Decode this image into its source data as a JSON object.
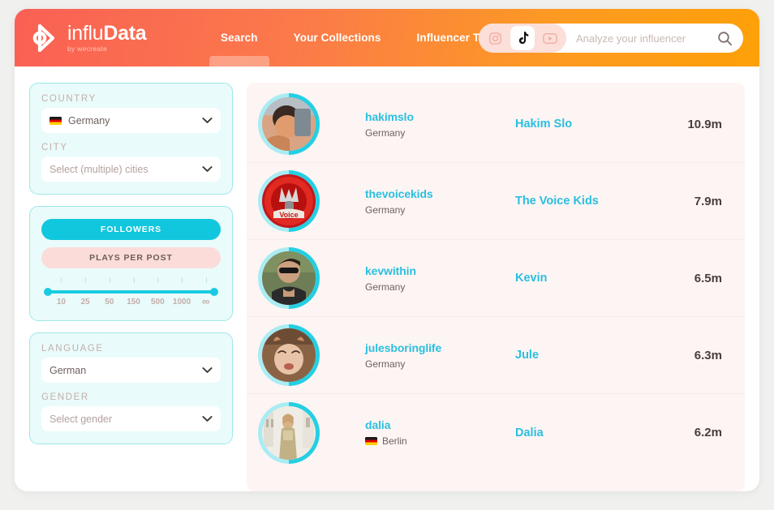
{
  "brand": {
    "name_light": "influ",
    "name_bold": "Data",
    "tagline": "by wecreate",
    "logo_icon": "infludata-logo-icon",
    "gradient_start": "#fa6055",
    "gradient_end": "#fda008"
  },
  "nav": {
    "items": [
      {
        "label": "Search",
        "active": true
      },
      {
        "label": "Your Collections",
        "active": false
      },
      {
        "label": "Influencer Tracking",
        "active": false
      }
    ]
  },
  "search": {
    "placeholder": "Analyze your influencer",
    "value": "",
    "search_icon": "search-icon",
    "platforms": [
      {
        "name": "instagram",
        "icon": "instagram-icon",
        "active": false
      },
      {
        "name": "tiktok",
        "icon": "tiktok-icon",
        "active": true
      },
      {
        "name": "youtube",
        "icon": "youtube-icon",
        "active": false
      }
    ]
  },
  "filters": {
    "country_label": "COUNTRY",
    "country_value": "Germany",
    "country_flag": "germany-flag-icon",
    "city_label": "CITY",
    "city_placeholder": "Select (multiple) cities",
    "metric_primary": "FOLLOWERS",
    "metric_secondary": "PLAYS PER POST",
    "slider_ticks": [
      "10",
      "25",
      "50",
      "150",
      "500",
      "1000",
      "∞"
    ],
    "language_label": "LANGUAGE",
    "language_value": "German",
    "gender_label": "GENDER",
    "gender_placeholder": "Select gender",
    "accent_color": "#11c7dd",
    "panel_bg": "#e9fbfa"
  },
  "results": [
    {
      "handle": "hakimslo",
      "location": "Germany",
      "has_flag": false,
      "name": "Hakim Slo",
      "followers": "10.9m",
      "avatar_colors": [
        "#c98f6e",
        "#8a6a58",
        "#e0b89a"
      ]
    },
    {
      "handle": "thevoicekids",
      "location": "Germany",
      "has_flag": false,
      "name": "The Voice Kids",
      "followers": "7.9m",
      "avatar_colors": [
        "#c81a1a",
        "#8e0f0f",
        "#e63030"
      ]
    },
    {
      "handle": "kevwithin",
      "location": "Germany",
      "has_flag": false,
      "name": "Kevin",
      "followers": "6.5m",
      "avatar_colors": [
        "#5c6b4a",
        "#2e2e2e",
        "#7e8b63"
      ]
    },
    {
      "handle": "julesboringlife",
      "location": "Germany",
      "has_flag": false,
      "name": "Jule",
      "followers": "6.3m",
      "avatar_colors": [
        "#8d6a50",
        "#d8b49a",
        "#5e4433"
      ]
    },
    {
      "handle": "dalia",
      "location": "Berlin",
      "has_flag": true,
      "name": "Dalia",
      "followers": "6.2m",
      "avatar_colors": [
        "#e8e6e1",
        "#c9b89c",
        "#f2f0ec"
      ]
    }
  ]
}
